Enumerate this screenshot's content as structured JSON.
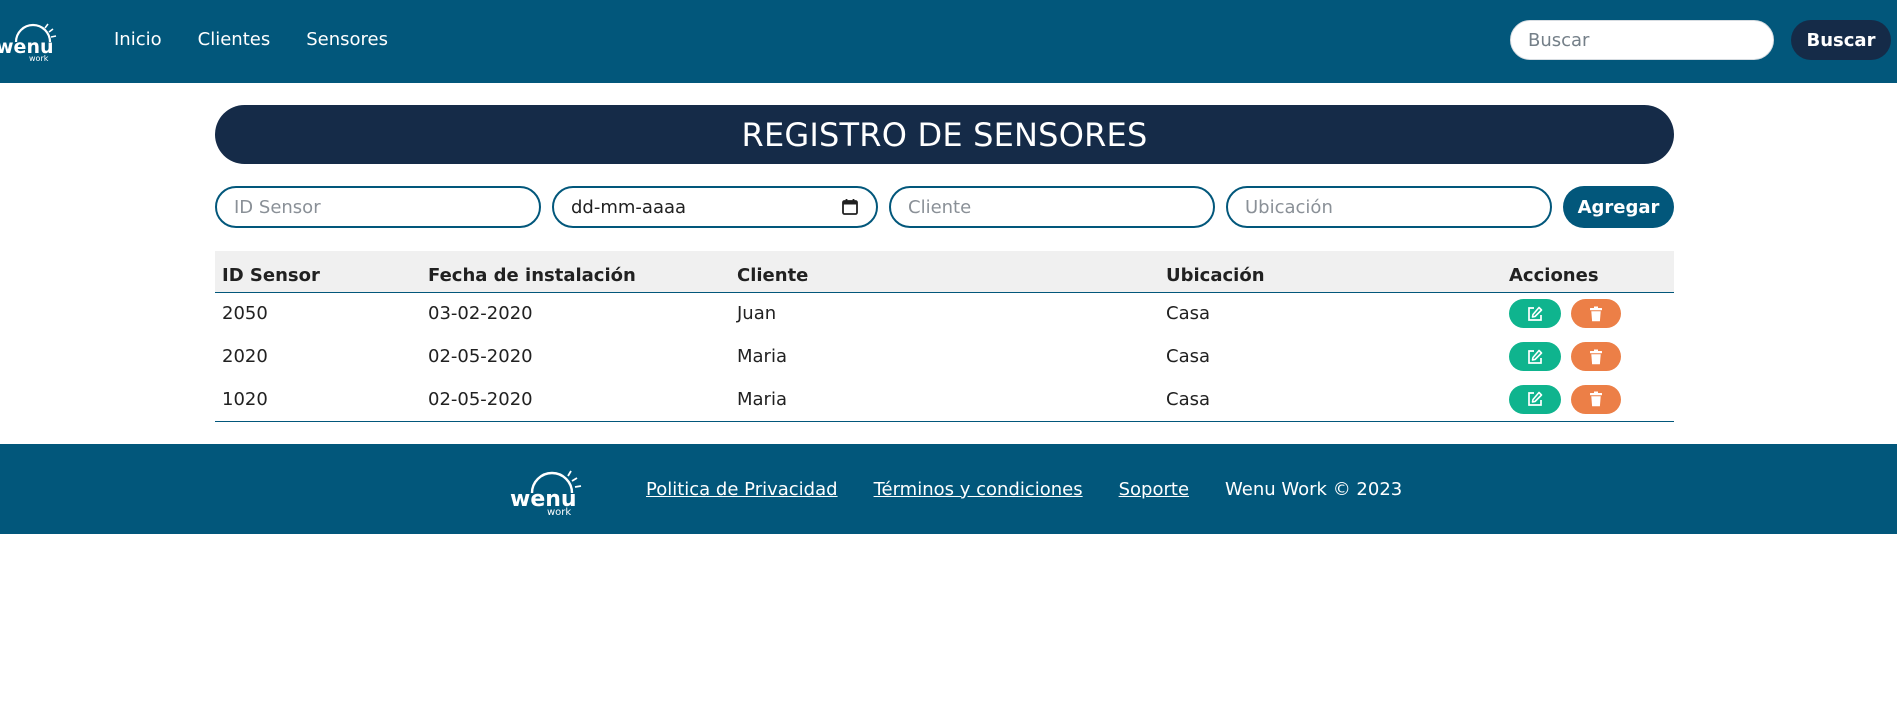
{
  "navbar": {
    "logo_text": "wenu",
    "logo_subtext": "work",
    "links": [
      "Inicio",
      "Clientes",
      "Sensores"
    ],
    "search_placeholder": "Buscar",
    "search_button": "Buscar"
  },
  "page": {
    "title": "REGISTRO DE SENSORES"
  },
  "form": {
    "id_placeholder": "ID Sensor",
    "date_placeholder": "dd-mm-aaaa",
    "client_placeholder": "Cliente",
    "location_placeholder": "Ubicación",
    "add_button": "Agregar"
  },
  "table": {
    "headers": [
      "ID Sensor",
      "Fecha de instalación",
      "Cliente",
      "Ubicación",
      "Acciones"
    ],
    "rows": [
      {
        "id": "2050",
        "date": "03-02-2020",
        "client": "Juan",
        "location": "Casa"
      },
      {
        "id": "2020",
        "date": "02-05-2020",
        "client": "Maria",
        "location": "Casa"
      },
      {
        "id": "1020",
        "date": "02-05-2020",
        "client": "Maria",
        "location": "Casa"
      }
    ]
  },
  "footer": {
    "links": [
      "Politica de Privacidad",
      "Términos y condiciones",
      "Soporte"
    ],
    "copyright": "Wenu Work © 2023"
  },
  "colors": {
    "primary": "#02577b",
    "dark": "#152b48",
    "edit": "#0fb48e",
    "delete": "#ec7f47"
  },
  "icons": [
    "calendar-icon",
    "edit-icon",
    "trash-icon"
  ]
}
